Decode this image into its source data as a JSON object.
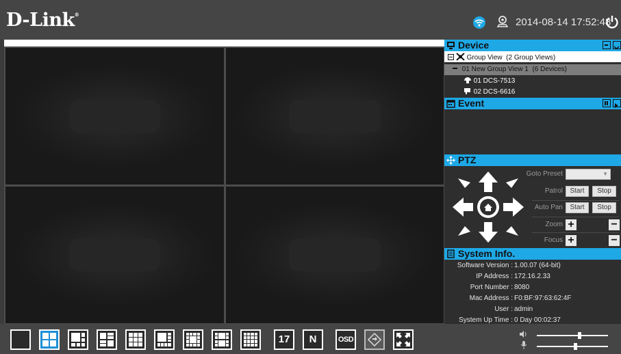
{
  "header": {
    "logo": "D-Link",
    "logo_mark": "®",
    "datetime": "2014-08-14 17:52:48",
    "icons": [
      "wifi-icon",
      "location-icon",
      "power-icon"
    ]
  },
  "video_grid": {
    "layout": "2x2",
    "tiles": 4
  },
  "device_panel": {
    "title": "Device",
    "group_view": "Group View  (2 Group Views)",
    "group_view_1": "01 New Group View 1  (6 Devices)",
    "cameras": [
      {
        "label": "01 DCS-7513",
        "icon": "dome-camera-icon"
      },
      {
        "label": "02 DCS-6616",
        "icon": "box-camera-icon"
      }
    ]
  },
  "event_panel": {
    "title": "Event"
  },
  "ptz_panel": {
    "title": "PTZ",
    "goto_preset_label": "Goto Preset",
    "goto_preset_value": "",
    "patrol_label": "Patrol",
    "patrol_start": "Start",
    "patrol_stop": "Stop",
    "autopan_label": "Auto Pan",
    "autopan_start": "Start",
    "autopan_stop": "Stop",
    "zoom_label": "Zoom",
    "focus_label": "Focus",
    "plus": "+",
    "minus": "−"
  },
  "system_info": {
    "title": "System Info.",
    "rows": [
      {
        "key": "Software Version :",
        "value": "1.00.07 (64-bit)"
      },
      {
        "key": "IP Address :",
        "value": "172.16.2.33"
      },
      {
        "key": "Port Number :",
        "value": "8080"
      },
      {
        "key": "Mac Address :",
        "value": "F0:BF:97:63:62:4F"
      },
      {
        "key": "User :",
        "value": "admin"
      },
      {
        "key": "System Up Time :",
        "value": "0 Day 00:02:37"
      }
    ]
  },
  "toolbar": {
    "selected_layout": "2x2",
    "buttons": [
      "1x1",
      "2x2",
      "1+5",
      "2+6",
      "3x3-mixed",
      "1+7",
      "1+12",
      "2+8",
      "4x4",
      "17",
      "N",
      "OSD",
      "sequence",
      "fullscreen"
    ],
    "label_17": "17",
    "label_n": "N",
    "label_osd": "OSD",
    "volume_level": 0.6,
    "mic_level": 0.54
  },
  "colors": {
    "accent": "#1ea8e6",
    "topbar": "#454545",
    "panel": "#2e2e2e"
  }
}
